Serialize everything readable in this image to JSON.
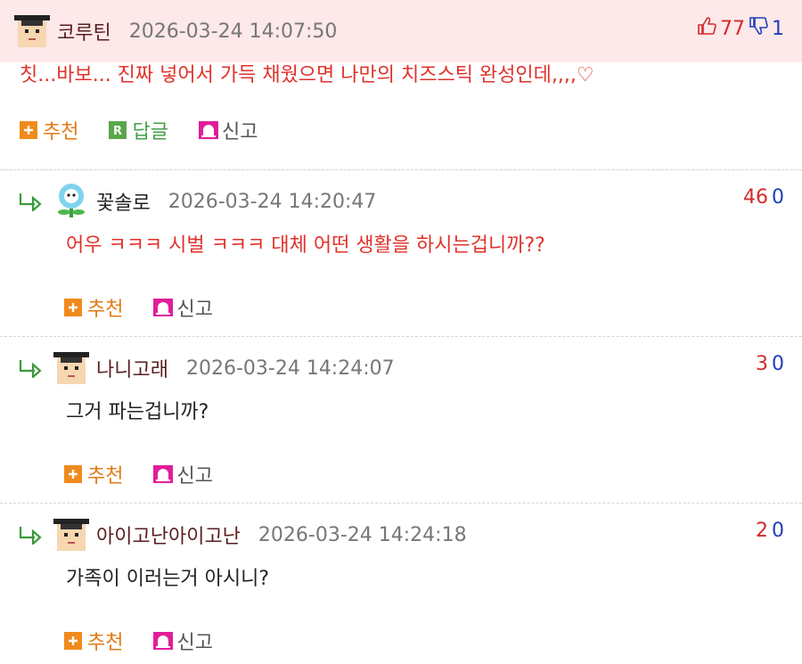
{
  "top": {
    "nickname": "코루틴",
    "date": "2026-03-24 14:07:50",
    "up_count": "77",
    "down_count": "1",
    "text": "칫...바보... 진짜 넣어서 가득 채웠으면 나만의 치즈스틱 완성인데,,,,♡",
    "actions": {
      "recommend": "추천",
      "reply": "답글",
      "report": "신고"
    }
  },
  "replies": [
    {
      "nickname": "꽃솔로",
      "date": "2026-03-24 14:20:47",
      "up_count": "46",
      "down_count": "0",
      "text": "어우 ㅋㅋㅋ 시벌 ㅋㅋㅋ 대체 어떤 생활을 하시는겁니까??",
      "actions": {
        "recommend": "추천",
        "report": "신고"
      },
      "avatar_icon": "flower-icon"
    },
    {
      "nickname": "나니고래",
      "date": "2026-03-24 14:24:07",
      "up_count": "3",
      "down_count": "0",
      "text": "그거 파는겁니까?",
      "actions": {
        "recommend": "추천",
        "report": "신고"
      },
      "avatar_icon": "graduate-avatar-icon"
    },
    {
      "nickname": "아이고난아이고난",
      "date": "2026-03-24 14:24:18",
      "up_count": "2",
      "down_count": "0",
      "text": "가족이 이러는거 아시니?",
      "actions": {
        "recommend": "추천",
        "report": "신고"
      },
      "avatar_icon": "graduate-avatar-icon"
    }
  ],
  "colors": {
    "top_bg": "#fde8ea",
    "highlight_text": "#e0322b",
    "recommend": "#e27a14",
    "reply": "#43a047",
    "report_icon": "#d81b8c",
    "upvote": "#d32b2b",
    "downvote": "#1f3fb8"
  }
}
